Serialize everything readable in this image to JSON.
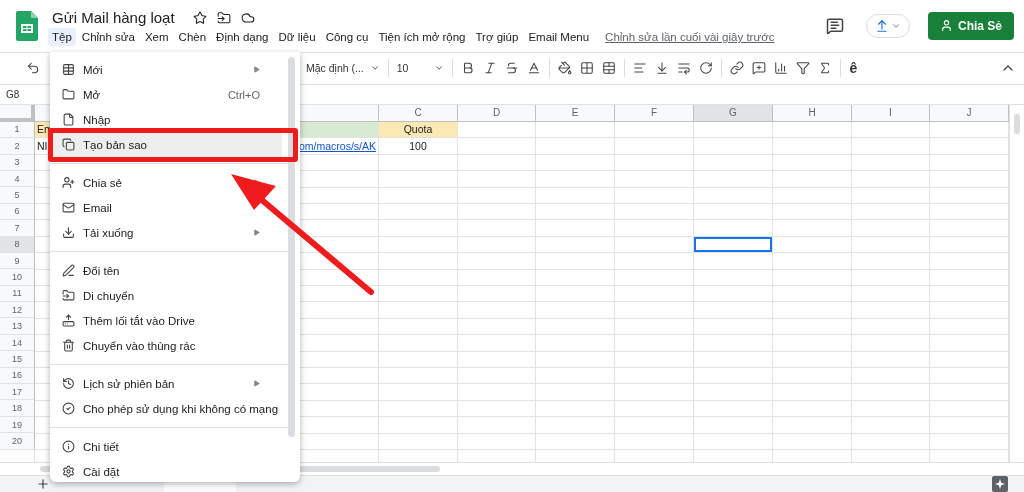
{
  "document": {
    "title": "Gửi Mail hàng loạt"
  },
  "menu_bar": {
    "items": [
      {
        "label": "Tệp",
        "selected": true
      },
      {
        "label": "Chỉnh sửa",
        "selected": false
      },
      {
        "label": "Xem",
        "selected": false
      },
      {
        "label": "Chèn",
        "selected": false
      },
      {
        "label": "Định dạng",
        "selected": false
      },
      {
        "label": "Dữ liệu",
        "selected": false
      },
      {
        "label": "Công cụ",
        "selected": false
      },
      {
        "label": "Tiện ích mở rộng",
        "selected": false
      },
      {
        "label": "Trợ giúp",
        "selected": false
      },
      {
        "label": "Email Menu",
        "selected": false
      }
    ],
    "last_edit": "Chỉnh sửa lần cuối vài giây trước"
  },
  "share_button": {
    "label": "Chia Sẻ"
  },
  "toolbar": {
    "font": "Mặc định (...",
    "font_size": "10",
    "input_tool": "ê"
  },
  "name_box": "G8",
  "sheet": {
    "columns": [
      {
        "selected": false
      },
      {
        "selected": false
      },
      {
        "label": "C",
        "selected": false
      },
      {
        "label": "D",
        "selected": false
      },
      {
        "label": "E",
        "selected": false
      },
      {
        "label": "F",
        "selected": false
      },
      {
        "label": "G",
        "selected": true
      },
      {
        "label": "H",
        "selected": false
      },
      {
        "label": "I",
        "selected": false
      },
      {
        "label": "J",
        "selected": false
      }
    ],
    "rows": [
      {
        "number": "1",
        "selected": false,
        "cells": [
          {
            "text": "Em",
            "color": "#fce8b2"
          },
          {
            "color": "#d9ead3"
          },
          {
            "text": "Quota",
            "color": "#fce8b2"
          }
        ]
      },
      {
        "number": "2",
        "selected": false,
        "cells": [
          {
            "text": "NI"
          },
          {
            "text": "om/macros/s/AK",
            "kind": "link"
          },
          {
            "text": "100"
          }
        ]
      },
      {
        "number": "3",
        "selected": false
      },
      {
        "number": "4",
        "selected": false
      },
      {
        "number": "5",
        "selected": false
      },
      {
        "number": "6",
        "selected": false
      },
      {
        "number": "7",
        "selected": false
      },
      {
        "number": "8",
        "selected": true
      },
      {
        "number": "9",
        "selected": false
      },
      {
        "number": "10",
        "selected": false
      },
      {
        "number": "11",
        "selected": false
      },
      {
        "number": "12",
        "selected": false
      },
      {
        "number": "13",
        "selected": false
      },
      {
        "number": "14",
        "selected": false
      },
      {
        "number": "15",
        "selected": false
      },
      {
        "number": "16",
        "selected": false
      },
      {
        "number": "17",
        "selected": false
      },
      {
        "number": "18",
        "selected": false
      },
      {
        "number": "19",
        "selected": false
      },
      {
        "number": "20",
        "selected": false
      }
    ]
  },
  "file_menu": {
    "items": [
      {
        "kind": "item",
        "label": "Mới",
        "submenu": true,
        "selected": false
      },
      {
        "kind": "item",
        "label": "Mở",
        "shortcut": "Ctrl+O",
        "selected": false
      },
      {
        "kind": "item",
        "label": "Nhập",
        "selected": false
      },
      {
        "kind": "item",
        "label": "Tạo bản sao",
        "selected": true
      },
      {
        "kind": "divider"
      },
      {
        "kind": "item",
        "label": "Chia sẻ",
        "submenu": true,
        "selected": false
      },
      {
        "kind": "item",
        "label": "Email",
        "selected": false
      },
      {
        "kind": "item",
        "label": "Tải xuống",
        "submenu": true,
        "selected": false
      },
      {
        "kind": "divider"
      },
      {
        "kind": "item",
        "label": "Đổi tên",
        "selected": false
      },
      {
        "kind": "item",
        "label": "Di chuyển",
        "selected": false
      },
      {
        "kind": "item",
        "label": "Thêm lối tắt vào Drive",
        "selected": false
      },
      {
        "kind": "item",
        "label": "Chuyển vào thùng rác",
        "selected": false
      },
      {
        "kind": "divider"
      },
      {
        "kind": "item",
        "label": "Lịch sử phiên bản",
        "submenu": true,
        "selected": false
      },
      {
        "kind": "item",
        "label": "Cho phép sử dụng khi không có mạng",
        "selected": false
      },
      {
        "kind": "divider"
      },
      {
        "kind": "item",
        "label": "Chi tiết",
        "selected": false
      },
      {
        "kind": "item",
        "label": "Cài đặt",
        "selected": false
      }
    ]
  }
}
